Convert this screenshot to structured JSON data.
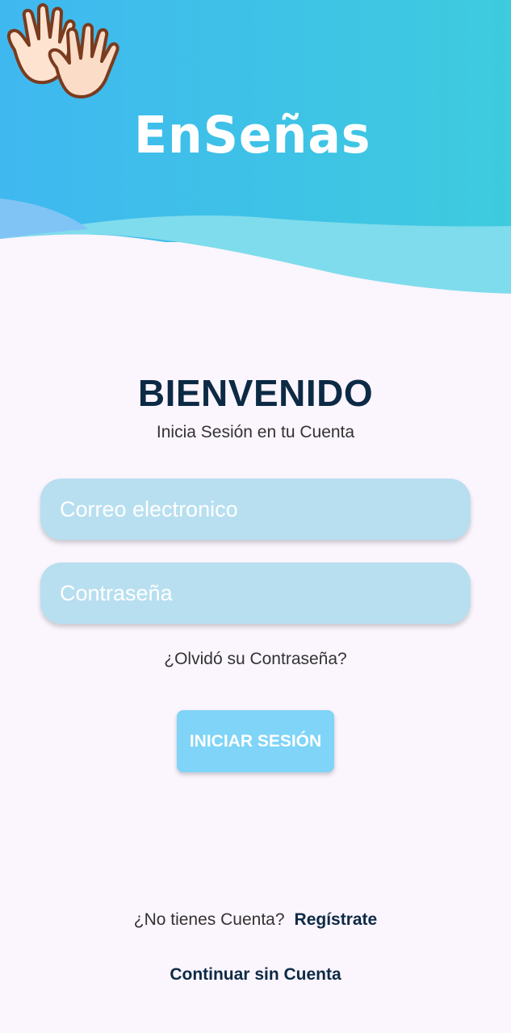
{
  "brand": {
    "logo_text": "EnSeñas",
    "colors": {
      "header_gradient_start": "#3fb8f0",
      "header_gradient_end": "#3ecbde",
      "wave_light": "#7fdcec",
      "accent_dark": "#0d2a45"
    }
  },
  "welcome": {
    "title": "BIENVENIDO",
    "subtitle": "Inicia Sesión en tu Cuenta"
  },
  "form": {
    "email_placeholder": "Correo electronico",
    "email_value": "",
    "password_placeholder": "Contraseña",
    "password_value": "",
    "forgot_label": "¿Olvidó su Contraseña?",
    "login_label": "INICIAR SESIÓN"
  },
  "footer": {
    "no_account_text": "¿No tienes Cuenta?",
    "register_label": "Regístrate",
    "continue_label": "Continuar sin Cuenta"
  },
  "icons": {
    "hands": "waving-hands-icon"
  }
}
